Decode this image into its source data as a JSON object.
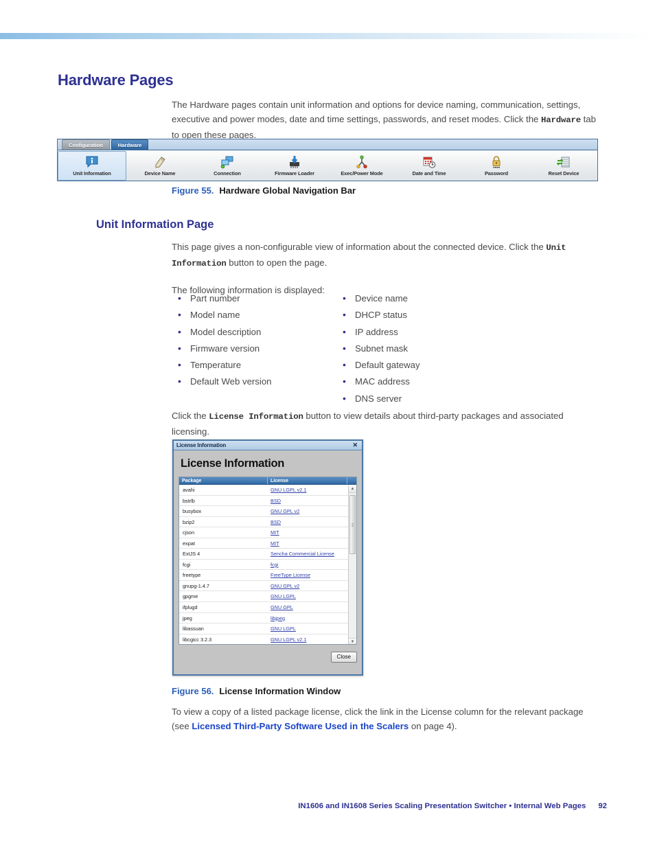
{
  "document": {
    "heading": "Hardware Pages",
    "intro_paragraph_part1": "The Hardware pages contain unit information and options for device naming, communication, settings, executive and power modes, date and time settings, passwords, and reset modes. Click the ",
    "intro_paragraph_mono": "Hardware",
    "intro_paragraph_part2": " tab to open these pages.",
    "figure55_number": "Figure 55.",
    "figure55_title": "Hardware Global Navigation Bar",
    "section_heading": "Unit Information Page",
    "unit_info_part1": "This page gives a non-configurable view of information about the connected device. Click the ",
    "unit_info_mono": "Unit Information",
    "unit_info_part2": " button to open the page.",
    "following_info": "The following information is displayed:",
    "license_intro_part1": "Click the ",
    "license_intro_mono": "License Information",
    "license_intro_part2": " button to view details about third-party packages and associated licensing.",
    "figure56_number": "Figure 56.",
    "figure56_title": "License Information Window",
    "closing_part1": "To view a copy of a listed package license, click the link in the License column for the relevant package (see ",
    "closing_link": "Licensed Third-Party Software Used in the Scalers",
    "closing_part2": " on page 4)."
  },
  "info_list": {
    "column_left": [
      "Part number",
      "Model name",
      "Model description",
      "Firmware version",
      "Temperature",
      "Default Web version"
    ],
    "column_right": [
      "Device name",
      "DHCP status",
      "IP address",
      "Subnet mask",
      "Default gateway",
      "MAC address",
      "DNS server"
    ]
  },
  "nav_bar": {
    "tabs": [
      {
        "label": "Configuration",
        "state": "inactive"
      },
      {
        "label": "Hardware",
        "state": "active"
      }
    ],
    "buttons": [
      {
        "label": "Unit Information",
        "icon": "info-balloon-icon",
        "selected": true
      },
      {
        "label": "Device Name",
        "icon": "tag-pencil-icon",
        "selected": false
      },
      {
        "label": "Connection",
        "icon": "network-windows-icon",
        "selected": false
      },
      {
        "label": "Firmware Loader",
        "icon": "chip-download-icon",
        "selected": false
      },
      {
        "label": "Exec/Power Mode",
        "icon": "node-tree-icon",
        "selected": false
      },
      {
        "label": "Date and Time",
        "icon": "calendar-clock-icon",
        "selected": false
      },
      {
        "label": "Password",
        "icon": "padlock-icon",
        "selected": false
      },
      {
        "label": "Reset Device",
        "icon": "server-arrows-icon",
        "selected": false
      }
    ]
  },
  "license_window": {
    "titlebar": "License Information",
    "close_icon": "close-x-icon",
    "heading": "License Information",
    "columns": [
      "Package",
      "License"
    ],
    "close_button": "Close",
    "scroll_up_icon": "scroll-up-arrow-icon",
    "scroll_down_icon": "scroll-down-arrow-icon",
    "rows": [
      {
        "package": "avahi",
        "license": "GNU LGPL v2.1"
      },
      {
        "package": "bstrlb",
        "license": "BSD"
      },
      {
        "package": "busybox",
        "license": "GNU GPL v2"
      },
      {
        "package": "bzip2",
        "license": "BSD"
      },
      {
        "package": "cjson",
        "license": "MIT"
      },
      {
        "package": "expat",
        "license": "MIT"
      },
      {
        "package": "ExtJS 4",
        "license": "Sencha Commercial License"
      },
      {
        "package": "fcgi",
        "license": "fcgi"
      },
      {
        "package": "freetype",
        "license": "FreeType License"
      },
      {
        "package": "gnupg-1.4.7",
        "license": "GNU GPL v2"
      },
      {
        "package": "gpgme",
        "license": "GNU LGPL"
      },
      {
        "package": "ifplugd",
        "license": "GNU GPL"
      },
      {
        "package": "jpeg",
        "license": "libjpeg"
      },
      {
        "package": "libassuan",
        "license": "GNU LGPL"
      },
      {
        "package": "libcgicc 3.2.3",
        "license": "GNU LGPL v2.1"
      }
    ]
  },
  "footer": {
    "text": "IN1606 and IN1608 Series Scaling Presentation Switcher • Internal Web Pages",
    "page_number": "92"
  },
  "colors": {
    "heading_blue": "#2e3192",
    "figure_blue": "#2b5fb8",
    "link_blue": "#1a44c8",
    "tab_active": "#2d65a0",
    "band": "#9dc6e8"
  }
}
